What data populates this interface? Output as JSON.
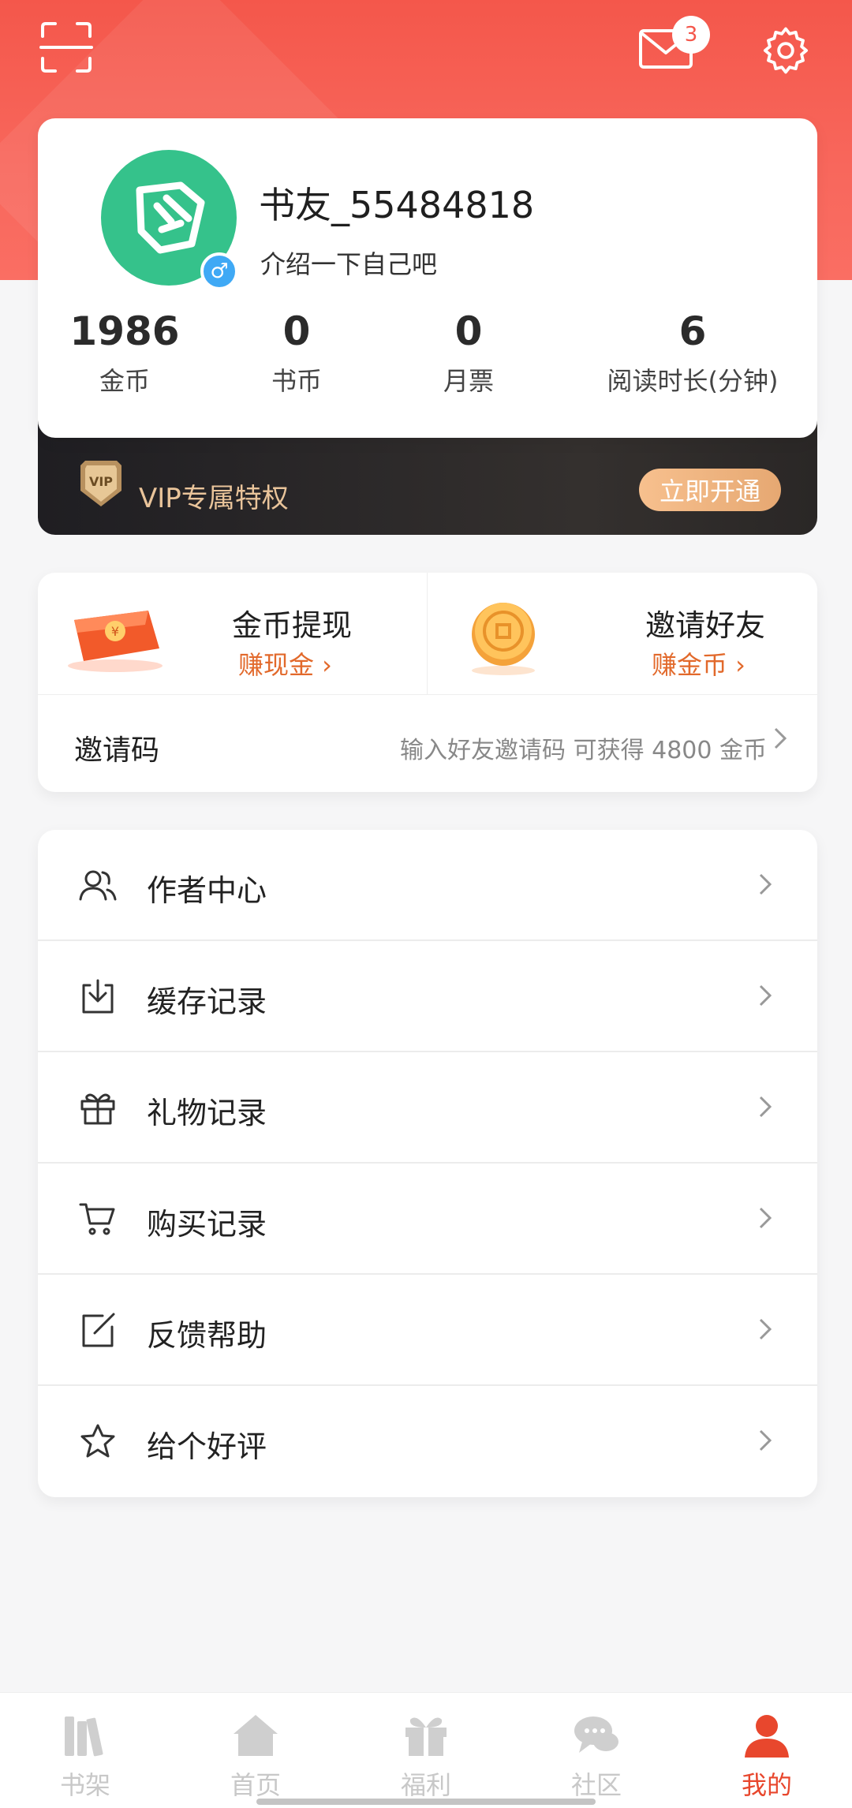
{
  "header": {
    "unread_messages": "3"
  },
  "profile": {
    "username": "书友_55484818",
    "bio": "介绍一下自己吧",
    "gender_symbol": "♂",
    "stats": [
      {
        "value": "1986",
        "label": "金币"
      },
      {
        "value": "0",
        "label": "书币"
      },
      {
        "value": "0",
        "label": "月票"
      },
      {
        "value": "6",
        "label": "阅读时长(分钟)"
      }
    ]
  },
  "vip": {
    "badge": "VIP",
    "text": "VIP专属特权",
    "button": "立即开通"
  },
  "earn": {
    "withdraw": {
      "title": "金币提现",
      "sub": "赚现金 ›"
    },
    "invite": {
      "title": "邀请好友",
      "sub": "赚金币 ›"
    },
    "code": {
      "label": "邀请码",
      "hint": "输入好友邀请码 可获得 4800 金币"
    }
  },
  "menu": [
    {
      "label": "作者中心",
      "icon": "user-group-icon"
    },
    {
      "label": "缓存记录",
      "icon": "download-icon"
    },
    {
      "label": "礼物记录",
      "icon": "gift-icon"
    },
    {
      "label": "购买记录",
      "icon": "cart-icon"
    },
    {
      "label": "反馈帮助",
      "icon": "edit-icon"
    },
    {
      "label": "给个好评",
      "icon": "star-icon"
    }
  ],
  "tabs": [
    {
      "label": "书架",
      "icon": "bookshelf-icon"
    },
    {
      "label": "首页",
      "icon": "home-icon"
    },
    {
      "label": "福利",
      "icon": "gift-icon"
    },
    {
      "label": "社区",
      "icon": "chat-icon"
    },
    {
      "label": "我的",
      "icon": "person-icon",
      "active": true
    }
  ],
  "colors": {
    "brand_red": "#f4574b",
    "accent_orange": "#e2692b",
    "vip_gold": "#e9c49a",
    "tab_active": "#e8472d"
  }
}
